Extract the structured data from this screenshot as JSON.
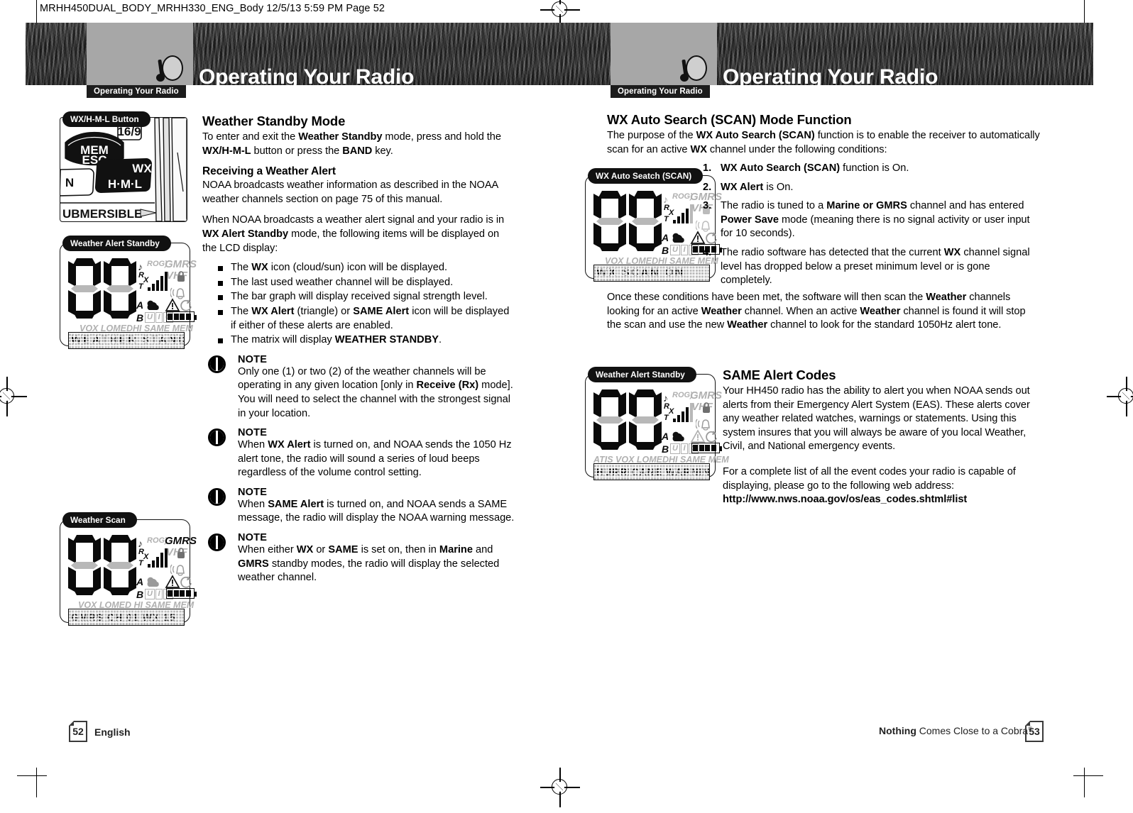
{
  "slug": "MRHH450DUAL_BODY_MRHH330_ENG_Body  12/5/13  5:59 PM  Page 52",
  "header": {
    "left_title": "Operating Your Radio",
    "left_tab": "Operating Your Radio",
    "right_title": "Operating Your Radio",
    "right_tab": "Operating Your Radio"
  },
  "left_page": {
    "figures": {
      "button_fig": {
        "label": "WX/H-M-L Button",
        "keys": [
          "MEM",
          "ESC",
          "WX",
          "H·M·L",
          "16/9",
          "N",
          "UBMERSIBLE"
        ]
      },
      "standby_fig": {
        "label": "Weather Alert Standby",
        "matrix_text": "WEATHER STANDBY",
        "status_row": "VOX LOMEDHI SAME MEM",
        "icons": [
          "ROG)",
          "GMRS",
          "VHF",
          "R",
          "X",
          "T",
          "A",
          "B",
          "U",
          "I",
          "C"
        ]
      },
      "scan_fig": {
        "label": "Weather Scan",
        "matrix_text": "GMRS CH 01  WX 15",
        "status_row": "VOX LOMED HI SAME MEM",
        "icons": [
          "ROG)",
          "GMRS",
          "VHF",
          "R",
          "X",
          "T",
          "A",
          "B",
          "U",
          "I",
          "C"
        ]
      }
    },
    "sections": [
      {
        "heading": "Weather Standby Mode",
        "paragraphs": [
          "To enter and exit the <b>Weather Standby</b> mode, press and hold the <b>WX/H-M-L</b> button or press the <b>BAND</b> key."
        ]
      },
      {
        "heading": "Receiving a Weather Alert",
        "paragraphs": [
          "NOAA broadcasts weather information as described in the NOAA weather channels section on page 75 of this manual.",
          "When NOAA broadcasts a weather alert signal and your radio is in <b>WX Alert Standby</b> mode, the following items will be displayed on the LCD display:"
        ]
      }
    ],
    "bullets": [
      "The <b>WX</b> icon (cloud/sun) icon will be displayed.",
      "The last used weather channel will be displayed.",
      "The bar graph will display received signal strength level.",
      "The <b>WX Alert</b> (triangle) or <b>SAME Alert</b> icon will be displayed if either of these alerts are enabled.",
      "The matrix will display <b>WEATHER STANDBY</b>."
    ],
    "notes": [
      {
        "title": "NOTE",
        "body": "Only one (1) or two (2) of the weather channels will be operating in any given location [only in <b>Receive (Rx)</b> mode]. You will need to select the channel with the strongest signal in your location."
      },
      {
        "title": "NOTE",
        "body": "When <b>WX Alert</b> is turned on, and NOAA sends the 1050 Hz alert tone, the radio will sound a series of loud beeps regardless of the volume control setting."
      },
      {
        "title": "NOTE",
        "body": "When <b>SAME Alert</b> is turned on, and NOAA sends a SAME message, the radio will display the NOAA warning message."
      },
      {
        "title": "NOTE",
        "body": "When either <b>WX</b> or <b>SAME</b> is set on, then in <b>Marine</b> and <b>GMRS</b> standby modes, the radio will display the selected weather channel."
      }
    ]
  },
  "right_page": {
    "figures": {
      "autoscan_fig": {
        "label": "WX Auto Seatch (SCAN)",
        "matrix_text": "WX SCAN ON",
        "status_row": "VOX LOMEDHI SAME MEM"
      },
      "same_fig": {
        "label": "Weather Alert Standby",
        "matrix_text": "HURRICANE WARNING",
        "status_row": "ATIS VOX LOMEDHI SAME MEM"
      }
    },
    "sections": [
      {
        "heading": "WX Auto Search (SCAN) Mode Function",
        "paragraphs": [
          "The purpose of the <b>WX Auto Search (SCAN)</b> function is to enable the receiver to automatically scan for an active <b>WX</b> channel under the following conditions:"
        ]
      }
    ],
    "numbered": [
      "<b>WX Auto Search (SCAN)</b> function is On.",
      "<b>WX Alert</b> is On.",
      "The radio is tuned to a <b>Marine or GMRS</b> channel and has entered <b>Power Save</b> mode (meaning there is no signal activity or user input for 10 seconds).",
      "The radio software has detected that the current <b>WX</b> channel signal level has dropped below a preset minimum level or is gone completely."
    ],
    "after_list": "Once these conditions have been met, the software will then scan the <b>Weather</b> channels looking for an active <b>Weather</b> channel. When an active <b>Weather</b> channel is found it will stop the scan and use the new <b>Weather</b> channel to look for the standard 1050Hz alert tone.",
    "same_section": {
      "heading": "SAME Alert Codes",
      "paragraphs": [
        "Your HH450 radio has the ability to alert you when NOAA sends out alerts from their Emergency Alert System (EAS). These alerts cover any weather related watches, warnings or statements. Using this system insures that you will always be aware of you local Weather, Civil, and National emergency events.",
        "For a complete list of all the event codes your radio is capable of displaying, please go to the following web address: <b>http://www.nws.noaa.gov/os/eas_codes.shtml#list</b>"
      ]
    }
  },
  "footer": {
    "left_page_number": "52",
    "left_label": "English",
    "tagline_bold": "Nothing",
    "tagline_rest": " Comes Close to a Cobra",
    "tagline_mark": "®",
    "right_page_number": "53"
  }
}
